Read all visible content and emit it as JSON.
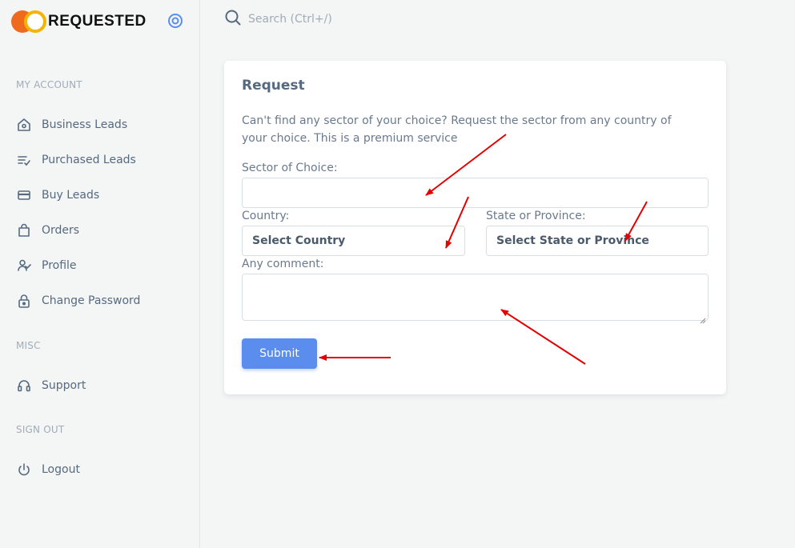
{
  "brand": {
    "name": "REQUESTED"
  },
  "search": {
    "placeholder": "Search (Ctrl+/)"
  },
  "sidebar": {
    "sections": [
      {
        "header": "MY ACCOUNT"
      },
      {
        "header": "MISC"
      },
      {
        "header": "SIGN OUT"
      }
    ],
    "items": [
      {
        "label": "Business Leads",
        "icon": "home-icon"
      },
      {
        "label": "Purchased Leads",
        "icon": "playlist-check-icon"
      },
      {
        "label": "Buy Leads",
        "icon": "credit-card-icon"
      },
      {
        "label": "Orders",
        "icon": "shopping-bag-icon"
      },
      {
        "label": "Profile",
        "icon": "user-check-icon"
      },
      {
        "label": "Change Password",
        "icon": "lock-icon"
      },
      {
        "label": "Support",
        "icon": "headphones-icon"
      },
      {
        "label": "Logout",
        "icon": "power-icon"
      }
    ]
  },
  "card": {
    "title": "Request",
    "description": "Can't find any sector of your choice? Request the sector from any country of your choice. This is a premium service",
    "fields": {
      "sector": {
        "label": "Sector of Choice:",
        "value": ""
      },
      "country": {
        "label": "Country:",
        "selected": "Select Country"
      },
      "state": {
        "label": "State or Province:",
        "selected": "Select State or Province"
      },
      "comment": {
        "label": "Any comment:",
        "value": ""
      }
    },
    "submit_label": "Submit"
  },
  "colors": {
    "accent": "#5b8def",
    "annotation_arrow": "#e60000",
    "logo_orange": "#f06a1d",
    "logo_yellow": "#f4b400"
  }
}
